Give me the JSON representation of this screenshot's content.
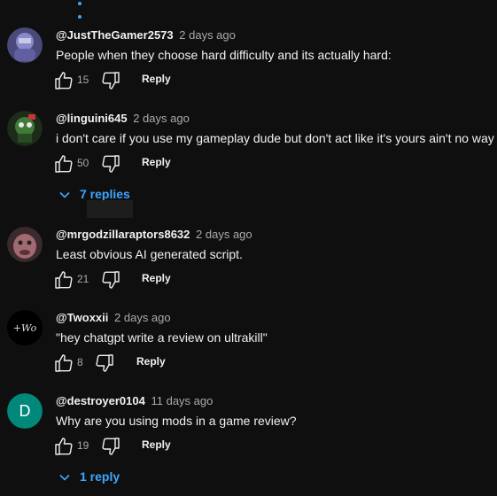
{
  "comments": [
    {
      "author": "@JustTheGamer2573",
      "time": "2 days ago",
      "text": "People when they choose hard difficulty and its actually hard:",
      "likes": "15",
      "reply_label": "Reply",
      "avatar_color": "#6f6fa8"
    },
    {
      "author": "@linguini645",
      "time": "2 days ago",
      "text": "i don't care if you use my gameplay dude but don't act like it's yours ain't no way y",
      "likes": "50",
      "reply_label": "Reply",
      "replies_label": "7 replies",
      "avatar_color": "#2f5a2a"
    },
    {
      "author": "@mrgodzillaraptors8632",
      "time": "2 days ago",
      "text": "Least obvious AI generated script.",
      "likes": "21",
      "reply_label": "Reply",
      "avatar_color": "#7a4a52"
    },
    {
      "author": "@Twoxxii",
      "time": "2 days ago",
      "text": "\"hey chatgpt write a review on ultrakill\"",
      "likes": "8",
      "reply_label": "Reply",
      "avatar_text": "+Wo",
      "avatar_color": "#000000"
    },
    {
      "author": "@destroyer0104",
      "time": "11 days ago",
      "text": "Why are you using mods in a game review?",
      "likes": "19",
      "reply_label": "Reply",
      "replies_label": "1 reply",
      "avatar_text": "D",
      "avatar_color": "#00897b"
    }
  ],
  "colors": {
    "background": "#0f0f0f",
    "link_blue": "#3ea6ff",
    "secondary_text": "#aaaaaa"
  }
}
